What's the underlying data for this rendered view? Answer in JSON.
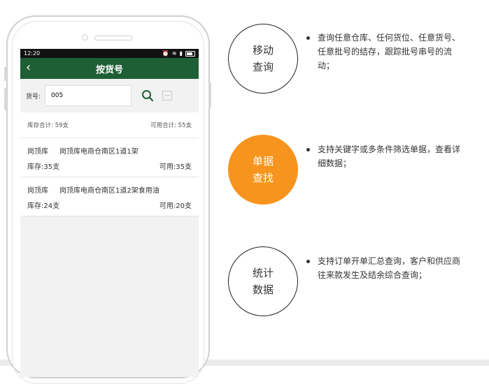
{
  "phone": {
    "status_time": "12:20",
    "app_title": "按货号",
    "search_label": "货号:",
    "search_value": "005",
    "totals": {
      "stock": "库存合计: 59支",
      "available": "可用合计: 55支"
    },
    "items": [
      {
        "warehouse": "岗顶库",
        "location": "岗顶库电商仓南区1道1架",
        "stock": "库存:35支",
        "available": "可用:35支"
      },
      {
        "warehouse": "岗顶库",
        "location": "岗顶库电商仓南区1道2架食用油",
        "stock": "库存:24支",
        "available": "可用:20支"
      }
    ]
  },
  "features": [
    {
      "title_line1": "移动",
      "title_line2": "查询",
      "desc": "查询任意仓库、任何货位、任意货号、任意批号的结存，跟踪批号串号的流动；"
    },
    {
      "title_line1": "单据",
      "title_line2": "查找",
      "desc": "支持关键字或多条件筛选单据，查看详细数据；"
    },
    {
      "title_line1": "统计",
      "title_line2": "数据",
      "desc": "支持订单开单汇总查询，客户和供应商往来款发生及结余综合查询；"
    }
  ],
  "colors": {
    "appbar": "#1e5f35",
    "accent": "#f7941d",
    "search_icon": "#1e5f35"
  },
  "icons": {
    "back": "chevron-left-icon",
    "search": "search-icon",
    "scan": "scan-icon"
  }
}
